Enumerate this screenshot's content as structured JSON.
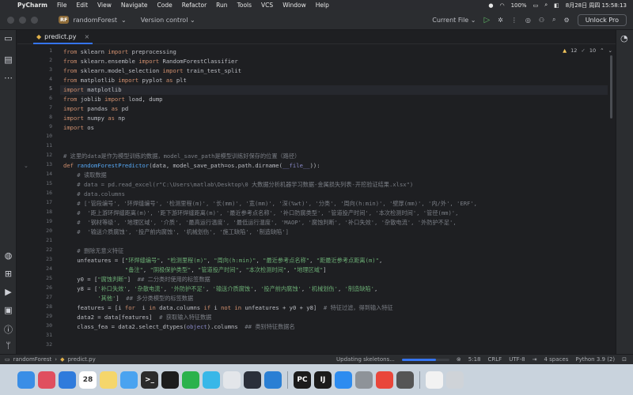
{
  "menubar": {
    "app": "PyCharm",
    "items": [
      "File",
      "Edit",
      "View",
      "Navigate",
      "Code",
      "Refactor",
      "Run",
      "Tools",
      "VCS",
      "Window",
      "Help"
    ],
    "battery": "100%",
    "datetime": "8月28日 周四  15:58:13"
  },
  "titlebar": {
    "project_badge": "RF",
    "project": "randomForest",
    "vcs": "Version control",
    "run_config": "Current File",
    "unlock": "Unlock Pro"
  },
  "tabs": [
    {
      "label": "predict.py",
      "active": true
    }
  ],
  "inspections": {
    "warnings": "12",
    "weak": "10"
  },
  "cursor_line": 5,
  "line_numbers": [
    "1",
    "2",
    "3",
    "4",
    "5",
    "6",
    "7",
    "8",
    "9",
    "10",
    "11",
    "12",
    "13",
    "14",
    "15",
    "16",
    "17",
    "18",
    "19",
    "20",
    "21",
    "22",
    "23",
    "24",
    "25",
    "26",
    "27",
    "28",
    "29",
    "30",
    "31",
    "32"
  ],
  "code_lines": [
    [
      [
        "kw",
        "from"
      ],
      [
        "",
        "sklearn "
      ],
      [
        "kw",
        "import"
      ],
      [
        "",
        "preprocessing"
      ]
    ],
    [
      [
        "kw",
        "from"
      ],
      [
        "",
        "sklearn.ensemble "
      ],
      [
        "kw",
        "import"
      ],
      [
        "",
        "RandomForestClassifier"
      ]
    ],
    [
      [
        "kw",
        "from"
      ],
      [
        "",
        "sklearn.model_selection "
      ],
      [
        "kw",
        "import"
      ],
      [
        "",
        "train_test_split"
      ]
    ],
    [
      [
        "kw",
        "from"
      ],
      [
        "",
        "matplotlib "
      ],
      [
        "kw",
        "import"
      ],
      [
        "",
        "pyplot "
      ],
      [
        "kw",
        "as"
      ],
      [
        "",
        "plt"
      ]
    ],
    [
      [
        "kw",
        "import"
      ],
      [
        "",
        "matplotlib"
      ]
    ],
    [
      [
        "kw",
        "from"
      ],
      [
        "",
        "joblib "
      ],
      [
        "kw",
        "import"
      ],
      [
        "",
        "load, dump"
      ]
    ],
    [
      [
        "kw",
        "import"
      ],
      [
        "",
        "pandas "
      ],
      [
        "kw",
        "as"
      ],
      [
        "",
        "pd"
      ]
    ],
    [
      [
        "kw",
        "import"
      ],
      [
        "",
        "numpy "
      ],
      [
        "kw",
        "as"
      ],
      [
        "",
        "np"
      ]
    ],
    [
      [
        "kw",
        "import"
      ],
      [
        "",
        "os"
      ]
    ],
    [],
    [],
    [
      [
        "cm",
        "# 这里的data是作为模型训练的数据，model_save_path是模型训练好保存的位置（路径）"
      ]
    ],
    [
      [
        "kw",
        "def "
      ],
      [
        "fn",
        "randomForestPredictor"
      ],
      [
        "",
        "(data, model_save_path=os.path.dirname("
      ],
      [
        "bi",
        "__file__"
      ],
      [
        "",
        "))"
      ],
      [
        "",
        ":"
      ]
    ],
    [
      [
        "cm",
        "    # 读取数据"
      ]
    ],
    [
      [
        "cm",
        "    # data = pd.read_excel(r\"C:\\Users\\matlab\\Desktop\\0 大数据分析机器学习数据-金属损失列表-开挖验证结果.xlsx\")"
      ]
    ],
    [
      [
        "cm",
        "    # data.columns"
      ]
    ],
    [
      [
        "cm",
        "    # ['管段编号', '环焊缝编号', '检测里程(m)', '长(mm)', '宽(mm)', '深(%wt)', '分类', '周向(h:min)', '壁厚(mm)', '内/外', 'ERF',"
      ]
    ],
    [
      [
        "cm",
        "    #  '距上游环焊缝距离(m)', '距下游环焊缝距离(m)', '最近参考点名称', '补口防腐类型', '管道投产时间', '本次检测时间', '管径(mm)',"
      ]
    ],
    [
      [
        "cm",
        "    #  '钢材等级', '地理区域', '介质', '最高运行温度', '最低运行温度', 'MAOP', '腐蚀判断', '补口失效', '杂散电流', '外防护不足',"
      ]
    ],
    [
      [
        "cm",
        "    #  '输送介质腐蚀', '投产前内腐蚀', '机械划伤', '施工缺陷', '制造缺陷']"
      ]
    ],
    [],
    [
      [
        "cm",
        "    # 删除无意义特征"
      ]
    ],
    [
      [
        "",
        "    unfeatures = ["
      ],
      [
        "st",
        "\"环焊缝编号\""
      ],
      [
        "",
        ", "
      ],
      [
        "st",
        "\"检测里程(m)\""
      ],
      [
        "",
        ", "
      ],
      [
        "st",
        "\"周向(h:min)\""
      ],
      [
        "",
        ", "
      ],
      [
        "st",
        "\"最近参考点名称\""
      ],
      [
        "",
        ", "
      ],
      [
        "st",
        "\"距最近参考点距离(m)\""
      ],
      [
        "",
        ","
      ]
    ],
    [
      [
        "",
        "                  "
      ],
      [
        "st",
        "\"备注\""
      ],
      [
        "",
        ", "
      ],
      [
        "st",
        "\"阴极保护类型\""
      ],
      [
        "",
        ", "
      ],
      [
        "st",
        "\"管道投产时间\""
      ],
      [
        "",
        ", "
      ],
      [
        "st",
        "\"本次检测时间\""
      ],
      [
        "",
        ", "
      ],
      [
        "st",
        "\"地理区域\""
      ],
      [
        "",
        "]"
      ]
    ],
    [
      [
        "",
        "    y0 = ["
      ],
      [
        "st",
        "\"腐蚀判断\""
      ],
      [
        "",
        "]  "
      ],
      [
        "cm",
        "## 二分类时使用的标签数据"
      ]
    ],
    [
      [
        "",
        "    y8 = ["
      ],
      [
        "st",
        "'补口失效'"
      ],
      [
        "",
        ", "
      ],
      [
        "st",
        "'杂散电流'"
      ],
      [
        "",
        ", "
      ],
      [
        "st",
        "'外防护不足'"
      ],
      [
        "",
        ", "
      ],
      [
        "st",
        "'输送介质腐蚀'"
      ],
      [
        "",
        ", "
      ],
      [
        "st",
        "'投产前内腐蚀'"
      ],
      [
        "",
        ", "
      ],
      [
        "st",
        "'机械划伤'"
      ],
      [
        "",
        ", "
      ],
      [
        "st",
        "'制造缺陷'"
      ],
      [
        "",
        ","
      ]
    ],
    [
      [
        "",
        "          "
      ],
      [
        "st",
        "'其他'"
      ],
      [
        "",
        "]  "
      ],
      [
        "cm",
        "## 多分类模型的标签数据"
      ]
    ],
    [
      [
        "",
        "    features = [i "
      ],
      [
        "kw",
        "for"
      ],
      [
        "",
        " i "
      ],
      [
        "kw",
        "in"
      ],
      [
        "",
        ""
      ],
      [
        "",
        ""
      ],
      [
        "",
        "data.columns "
      ],
      [
        "kw",
        "if"
      ],
      [
        "",
        ""
      ],
      [
        "",
        "i "
      ],
      [
        "kw",
        "not in"
      ],
      [
        "",
        ""
      ],
      [
        "",
        ""
      ],
      [
        "",
        "unfeatures + y0 + y8]  "
      ],
      [
        "cm",
        "# 特征过滤，得到输入特征"
      ]
    ],
    [
      [
        "",
        "    data2 = data[features]  "
      ],
      [
        "cm",
        "# 获取输入特征数据"
      ]
    ],
    [
      [
        "",
        "    class_fea = data2.select_dtypes("
      ],
      [
        "bi",
        "object"
      ],
      [
        "",
        ").columns  "
      ],
      [
        "cm",
        "## 类别特征数据名"
      ]
    ],
    [],
    []
  ],
  "statusbar": {
    "project": "randomForest",
    "file": "predict.py",
    "task": "Updating skeletons...",
    "task_progress": 0.72,
    "position": "5:18",
    "line_sep": "CRLF",
    "encoding": "UTF-8",
    "indent": "4 spaces",
    "interpreter": "Python 3.9 (2)"
  },
  "dock": [
    {
      "name": "finder",
      "glyph": "",
      "color": "#3a8ee6"
    },
    {
      "name": "launchpad",
      "glyph": "",
      "color": "#e04f5f"
    },
    {
      "name": "safari",
      "glyph": "",
      "color": "#2f7bdc"
    },
    {
      "name": "calendar",
      "glyph": "28",
      "color": "#ffffff"
    },
    {
      "name": "notes",
      "glyph": "",
      "color": "#f5d66b"
    },
    {
      "name": "maps",
      "glyph": "",
      "color": "#4aa3f0"
    },
    {
      "name": "terminal",
      "glyph": ">_",
      "color": "#2b2b2b"
    },
    {
      "name": "qq",
      "glyph": "",
      "color": "#1d1d1d"
    },
    {
      "name": "wechat",
      "glyph": "",
      "color": "#2bb24c"
    },
    {
      "name": "finder-2",
      "glyph": "",
      "color": "#38b7e8"
    },
    {
      "name": "app",
      "glyph": "",
      "color": "#e3e6ea"
    },
    {
      "name": "app-x",
      "glyph": "",
      "color": "#2a2f3a"
    },
    {
      "name": "vscode",
      "glyph": "",
      "color": "#2a7fd4"
    },
    {
      "name": "pycharm",
      "glyph": "PC",
      "color": "#1b1b1b"
    },
    {
      "name": "intellij",
      "glyph": "IJ",
      "color": "#1b1b1b"
    },
    {
      "name": "app-store",
      "glyph": "",
      "color": "#2d8cf0"
    },
    {
      "name": "system-settings",
      "glyph": "",
      "color": "#8e9399"
    },
    {
      "name": "chrome",
      "glyph": "",
      "color": "#e9463a"
    },
    {
      "name": "books",
      "glyph": "",
      "color": "#555555"
    },
    {
      "name": "document",
      "glyph": "",
      "color": "#f2f2f2"
    },
    {
      "name": "trash",
      "glyph": "",
      "color": "#cfd3d8"
    }
  ]
}
